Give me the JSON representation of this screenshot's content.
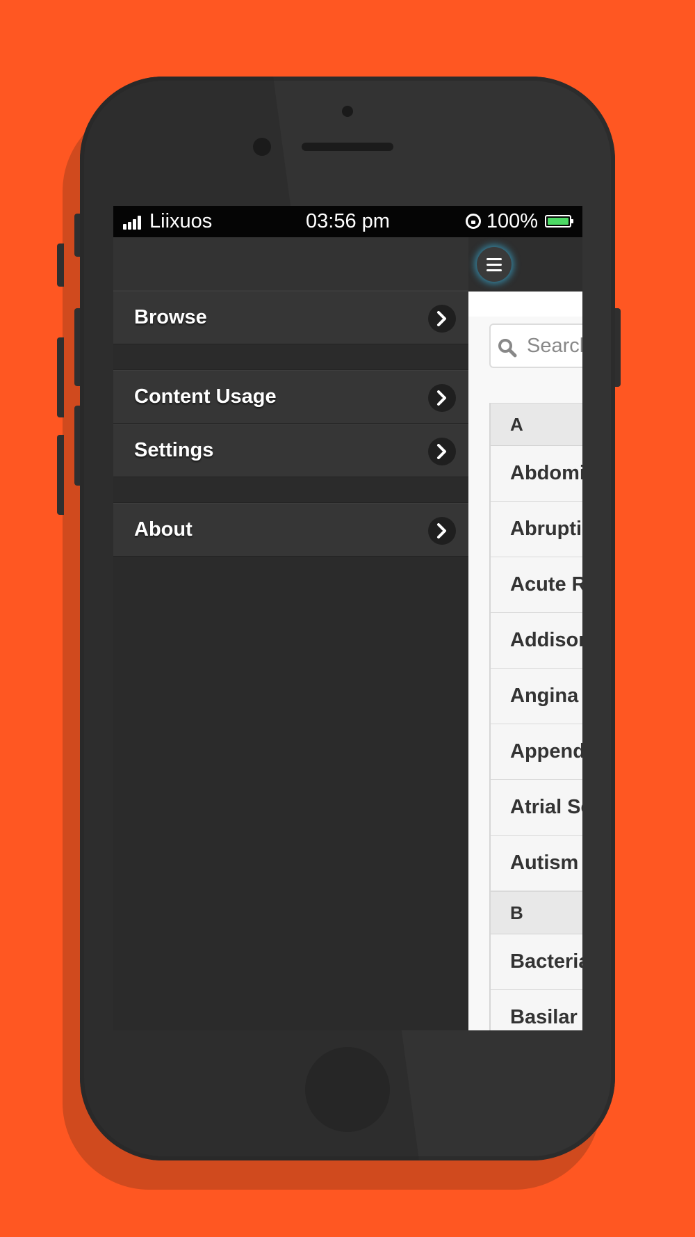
{
  "status_bar": {
    "carrier": "Liixuos",
    "time": "03:56 pm",
    "battery_percent": "100%",
    "battery_color": "#4cd964"
  },
  "menu": {
    "items": [
      {
        "label": "Browse",
        "icon": "chevron-right-icon"
      },
      {
        "label": "Content Usage",
        "icon": "chevron-right-icon"
      },
      {
        "label": "Settings",
        "icon": "chevron-right-icon"
      },
      {
        "label": "About",
        "icon": "chevron-right-icon"
      }
    ]
  },
  "content": {
    "menu_button_icon": "hamburger-icon",
    "search": {
      "placeholder": "Search",
      "icon": "search-icon"
    },
    "sections": [
      {
        "letter": "A",
        "items": [
          "Abdominal",
          "Abruption",
          "Acute Renal",
          "Addison's",
          "Angina",
          "Appendicitis",
          "Atrial Septal",
          "Autism"
        ]
      },
      {
        "letter": "B",
        "items": [
          "Bacterial",
          "Basilar"
        ]
      }
    ]
  },
  "colors": {
    "background": "#ff5722",
    "phone_body": "#333333",
    "menu_button_glow": "#38aad2"
  }
}
